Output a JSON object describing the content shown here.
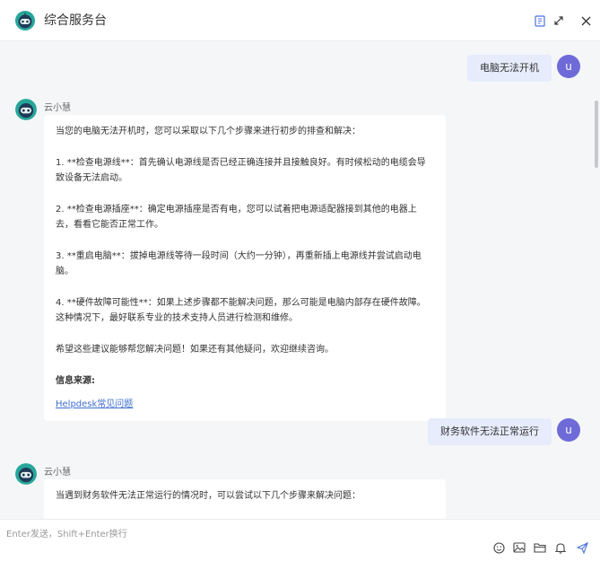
{
  "header": {
    "title": "综合服务台",
    "logo_icon": "robot-logo-icon",
    "actions": [
      "bookmark-icon",
      "expand-icon",
      "close-icon"
    ]
  },
  "messages": [
    {
      "role": "user",
      "avatar": "u",
      "text": "电脑无法开机"
    },
    {
      "role": "bot",
      "name": "云小慧",
      "paragraphs": [
        "当您的电脑无法开机时，您可以采取以下几个步骤来进行初步的排查和解决：",
        "1. **检查电源线**：首先确认电源线是否已经正确连接并且接触良好。有时候松动的电缆会导致设备无法启动。",
        "2. **检查电源插座**：确定电源插座是否有电，您可以试着把电源适配器接到其他的电器上去，看看它能否正常工作。",
        "3. **重启电脑**：拔掉电源线等待一段时间（大约一分钟），再重新插上电源线并尝试启动电脑。",
        "4. **硬件故障可能性**：如果上述步骤都不能解决问题，那么可能是电脑内部存在硬件故障。这种情况下，最好联系专业的技术支持人员进行检测和维修。",
        "希望这些建议能够帮您解决问题！如果还有其他疑问，欢迎继续咨询。"
      ],
      "source_title": "信息来源:",
      "source_link": "Helpdesk常见问题"
    },
    {
      "role": "user",
      "avatar": "u",
      "text": "财务软件无法正常运行"
    },
    {
      "role": "bot",
      "name": "云小慧",
      "paragraphs": [
        "当遇到财务软件无法正常运行的情况时，可以尝试以下几个步骤来解决问题："
      ]
    }
  ],
  "composer": {
    "placeholder": "Enter发送，Shift+Enter换行",
    "tools": [
      "emoji-icon",
      "image-icon",
      "folder-icon",
      "bell-icon",
      "send-icon"
    ]
  },
  "colors": {
    "accent": "#6e6bd8",
    "user_bubble": "#e6ecfb",
    "chat_bg": "#f5f6f8",
    "link": "#3f6fd1"
  }
}
